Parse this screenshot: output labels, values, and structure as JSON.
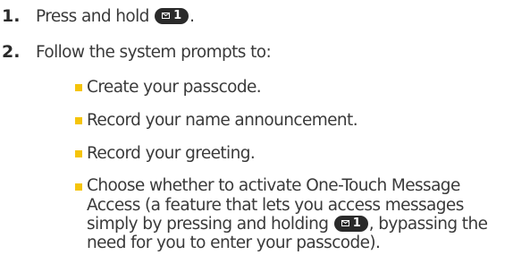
{
  "steps": [
    {
      "number": "1.",
      "text_before": "Press and hold",
      "text_after": "."
    },
    {
      "number": "2.",
      "text": "Follow the system prompts to:"
    }
  ],
  "bullets": [
    "Create your passcode.",
    "Record your name announcement.",
    "Record your greeting."
  ],
  "last_bullet": {
    "line1": "Choose whether to activate One-Touch Message",
    "line2": "Access (a feature that lets you access messages",
    "line3_before": "simply by pressing and holding",
    "line3_after": ", bypassing the",
    "line4": "need for you to enter your passcode)."
  },
  "key": {
    "icon": "envelope-icon",
    "digit": "1",
    "color": "#2a2a2a"
  },
  "colors": {
    "bullet": "#f5c40a",
    "text": "#3a3a3a"
  }
}
